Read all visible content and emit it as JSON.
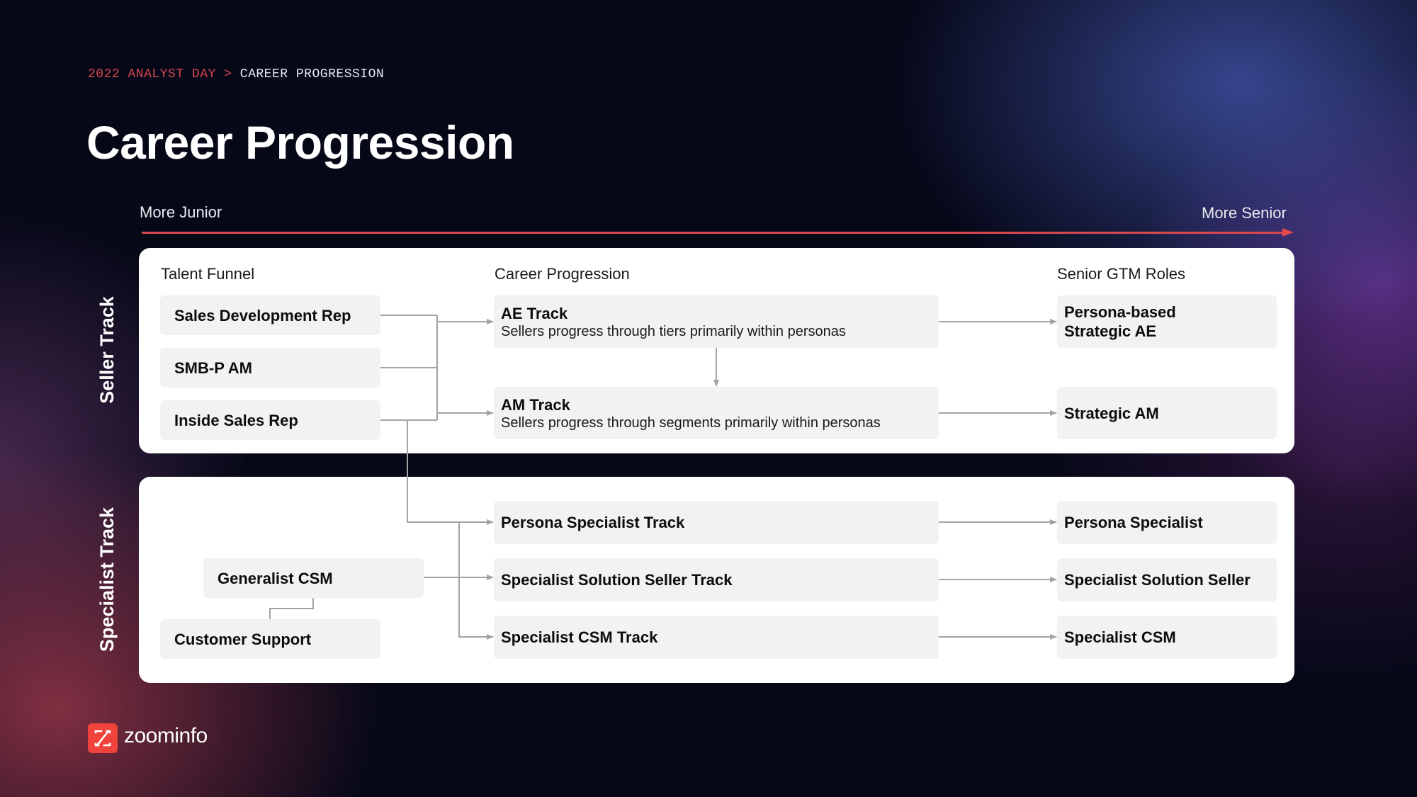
{
  "breadcrumb": {
    "section": "2022 ANALYST DAY",
    "separator": ">",
    "current": "CAREER PROGRESSION"
  },
  "title": "Career Progression",
  "axis": {
    "start_label": "More Junior",
    "end_label": "More Senior"
  },
  "columns": {
    "funnel": "Talent Funnel",
    "progression": "Career Progression",
    "senior": "Senior GTM Roles"
  },
  "seller_track": {
    "label": "Seller Track",
    "funnel": [
      "Sales Development Rep",
      "SMB-P AM",
      "Inside Sales Rep"
    ],
    "tracks": [
      {
        "name": "AE Track",
        "desc": "Sellers progress through tiers primarily within personas"
      },
      {
        "name": "AM Track",
        "desc": "Sellers progress through segments primarily within personas"
      }
    ],
    "senior": [
      "Persona-based Strategic AE",
      "Strategic AM"
    ]
  },
  "specialist_track": {
    "label": "Specialist Track",
    "funnel": [
      "Generalist CSM",
      "Customer Support"
    ],
    "tracks": [
      "Persona Specialist Track",
      "Specialist Solution Seller Track",
      "Specialist CSM Track"
    ],
    "senior": [
      "Persona Specialist",
      "Specialist Solution Seller",
      "Specialist CSM"
    ]
  },
  "brand": {
    "name": "zoominfo",
    "accent": "#f0433b",
    "axis_color": "#d9484f"
  }
}
